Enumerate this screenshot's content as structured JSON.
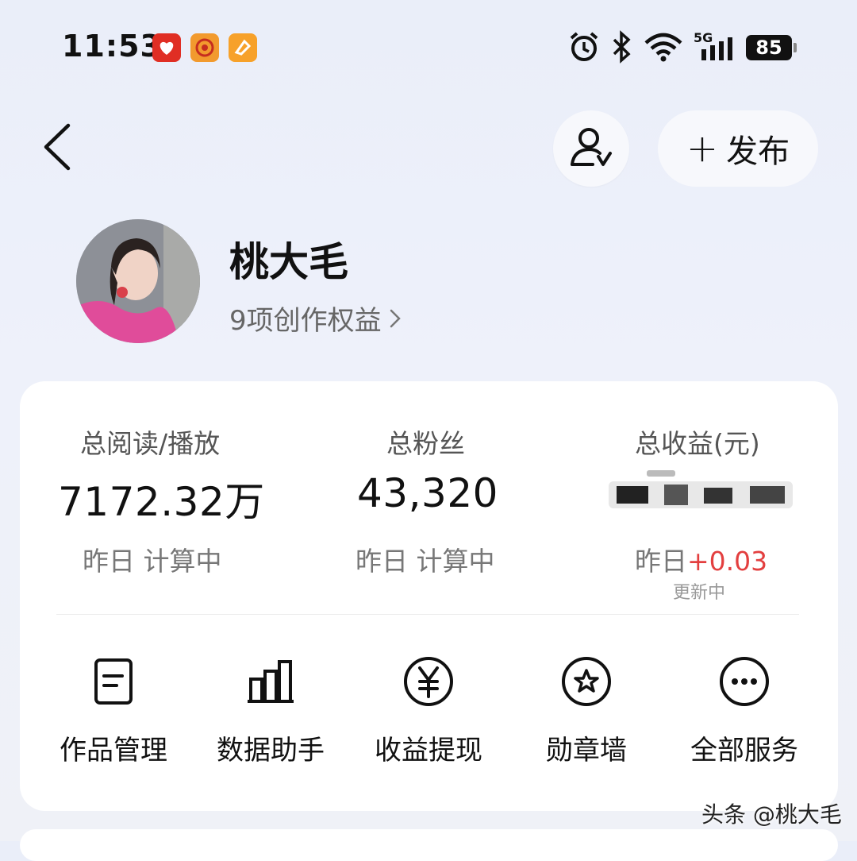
{
  "status_bar": {
    "time": "11:53",
    "battery": "85",
    "network": "5G"
  },
  "header": {
    "publish_label": "发布"
  },
  "profile": {
    "name": "桃大毛",
    "rights_text": "9项创作权益"
  },
  "stats": [
    {
      "label": "总阅读/播放",
      "value": "7172.32万",
      "sub_prefix": "昨日",
      "sub_value": "计算中"
    },
    {
      "label": "总粉丝",
      "value": "43,320",
      "sub_prefix": "昨日",
      "sub_value": "计算中"
    },
    {
      "label": "总收益(元)",
      "value_hidden": true,
      "sub_prefix": "昨日",
      "sub_value": "+0.03",
      "note": "更新中"
    }
  ],
  "services": [
    {
      "label": "作品管理",
      "icon": "document-icon"
    },
    {
      "label": "数据助手",
      "icon": "bar-chart-icon"
    },
    {
      "label": "收益提现",
      "icon": "yen-icon"
    },
    {
      "label": "勋章墙",
      "icon": "medal-star-icon"
    },
    {
      "label": "全部服务",
      "icon": "more-dots-icon"
    }
  ],
  "watermark": "头条 @桃大毛",
  "colors": {
    "accent_red": "#e33f3f",
    "background": "#eceff9",
    "card": "#ffffff"
  }
}
